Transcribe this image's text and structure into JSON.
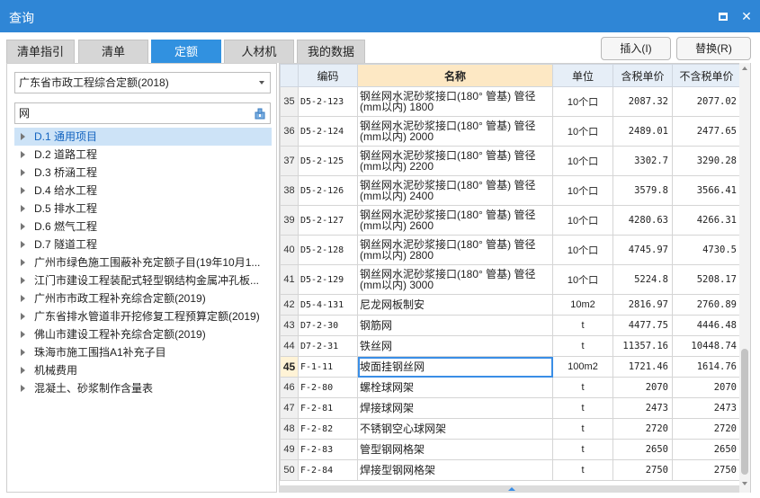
{
  "window": {
    "title": "查询",
    "maximize_icon": "maximize-icon",
    "close_icon": "close-icon",
    "close_glyph": "✕"
  },
  "tabs": [
    {
      "label": "清单指引",
      "active": false
    },
    {
      "label": "清单",
      "active": false
    },
    {
      "label": "定额",
      "active": true
    },
    {
      "label": "人材机",
      "active": false
    },
    {
      "label": "我的数据",
      "active": false
    }
  ],
  "actions": {
    "insert_label": "插入(I)",
    "replace_label": "替换(R)"
  },
  "left": {
    "quota_library": "广东省市政工程综合定额(2018)",
    "search_value": "网",
    "search_icon": "lookup-icon",
    "tree": [
      {
        "label": "D.1 通用项目",
        "selected": true
      },
      {
        "label": "D.2 道路工程",
        "selected": false
      },
      {
        "label": "D.3 桥涵工程",
        "selected": false
      },
      {
        "label": "D.4 给水工程",
        "selected": false
      },
      {
        "label": "D.5 排水工程",
        "selected": false
      },
      {
        "label": "D.6 燃气工程",
        "selected": false
      },
      {
        "label": "D.7 隧道工程",
        "selected": false
      },
      {
        "label": "广州市绿色施工围蔽补充定额子目(19年10月1...",
        "selected": false
      },
      {
        "label": "江门市建设工程装配式轻型钢结构金属冲孔板...",
        "selected": false
      },
      {
        "label": "广州市市政工程补充综合定额(2019)",
        "selected": false
      },
      {
        "label": "广东省排水管道非开挖修复工程预算定额(2019)",
        "selected": false
      },
      {
        "label": "佛山市建设工程补充综合定额(2019)",
        "selected": false
      },
      {
        "label": "珠海市施工围挡A1补充子目",
        "selected": false
      },
      {
        "label": "机械费用",
        "selected": false
      },
      {
        "label": "混凝土、砂浆制作含量表",
        "selected": false
      }
    ]
  },
  "grid": {
    "columns": [
      "",
      "编码",
      "名称",
      "单位",
      "含税单价",
      "不含税单价"
    ],
    "current_row": "45",
    "rows": [
      {
        "no": "35",
        "code": "D5-2-123",
        "name": "钢丝网水泥砂浆接口(180° 管基) 管径(mm以内) 1800",
        "unit": "10个口",
        "price_tax": "2087.32",
        "price_notax": "2077.02"
      },
      {
        "no": "36",
        "code": "D5-2-124",
        "name": "钢丝网水泥砂浆接口(180° 管基) 管径(mm以内) 2000",
        "unit": "10个口",
        "price_tax": "2489.01",
        "price_notax": "2477.65"
      },
      {
        "no": "37",
        "code": "D5-2-125",
        "name": "钢丝网水泥砂浆接口(180° 管基) 管径(mm以内) 2200",
        "unit": "10个口",
        "price_tax": "3302.7",
        "price_notax": "3290.28"
      },
      {
        "no": "38",
        "code": "D5-2-126",
        "name": "钢丝网水泥砂浆接口(180° 管基) 管径(mm以内) 2400",
        "unit": "10个口",
        "price_tax": "3579.8",
        "price_notax": "3566.41"
      },
      {
        "no": "39",
        "code": "D5-2-127",
        "name": "钢丝网水泥砂浆接口(180° 管基) 管径(mm以内) 2600",
        "unit": "10个口",
        "price_tax": "4280.63",
        "price_notax": "4266.31"
      },
      {
        "no": "40",
        "code": "D5-2-128",
        "name": "钢丝网水泥砂浆接口(180° 管基) 管径(mm以内) 2800",
        "unit": "10个口",
        "price_tax": "4745.97",
        "price_notax": "4730.5"
      },
      {
        "no": "41",
        "code": "D5-2-129",
        "name": "钢丝网水泥砂浆接口(180° 管基) 管径(mm以内) 3000",
        "unit": "10个口",
        "price_tax": "5224.8",
        "price_notax": "5208.17"
      },
      {
        "no": "42",
        "code": "D5-4-131",
        "name": "尼龙网板制安",
        "unit": "10m2",
        "price_tax": "2816.97",
        "price_notax": "2760.89"
      },
      {
        "no": "43",
        "code": "D7-2-30",
        "name": "钢筋网",
        "unit": "t",
        "price_tax": "4477.75",
        "price_notax": "4446.48"
      },
      {
        "no": "44",
        "code": "D7-2-31",
        "name": "铁丝网",
        "unit": "t",
        "price_tax": "11357.16",
        "price_notax": "10448.74"
      },
      {
        "no": "45",
        "code": "F-1-11",
        "name": "坡面挂钢丝网",
        "unit": "100m2",
        "price_tax": "1721.46",
        "price_notax": "1614.76"
      },
      {
        "no": "46",
        "code": "F-2-80",
        "name": "螺栓球网架",
        "unit": "t",
        "price_tax": "2070",
        "price_notax": "2070"
      },
      {
        "no": "47",
        "code": "F-2-81",
        "name": "焊接球网架",
        "unit": "t",
        "price_tax": "2473",
        "price_notax": "2473"
      },
      {
        "no": "48",
        "code": "F-2-82",
        "name": "不锈钢空心球网架",
        "unit": "t",
        "price_tax": "2720",
        "price_notax": "2720"
      },
      {
        "no": "49",
        "code": "F-2-83",
        "name": "管型钢网格架",
        "unit": "t",
        "price_tax": "2650",
        "price_notax": "2650"
      },
      {
        "no": "50",
        "code": "F-2-84",
        "name": "焊接型钢网格架",
        "unit": "t",
        "price_tax": "2750",
        "price_notax": "2750"
      }
    ]
  },
  "colors": {
    "titlebar": "#2f86d6",
    "active_tab": "#3191e0",
    "name_header": "#fde8c4",
    "tree_selected": "#cde3f7"
  }
}
